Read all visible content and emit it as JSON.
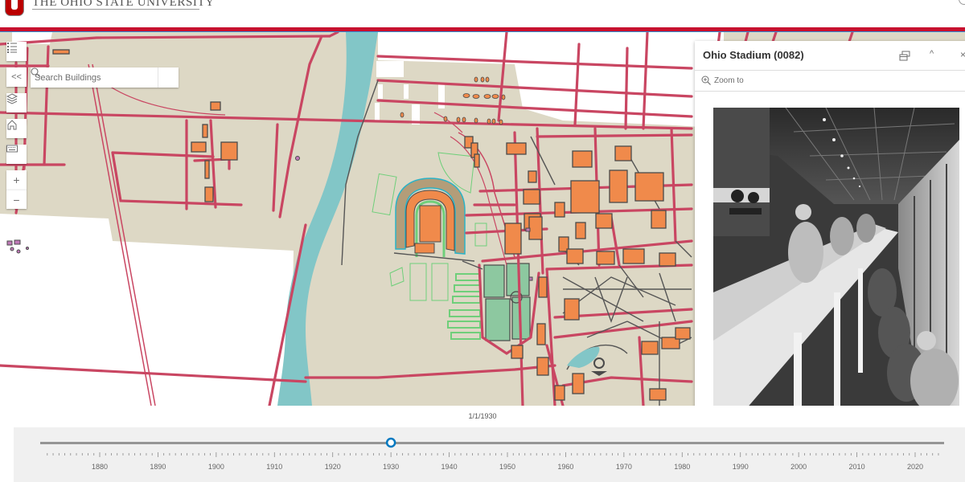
{
  "header": {
    "university_name": "THE OHIO STATE UNIVERSITY",
    "brand_color": "#c8102e"
  },
  "map_tools": {
    "legend_icon": "legend-list-icon",
    "collapse_label": "<<",
    "layers_icon": "layers-icon",
    "home_icon": "home-icon",
    "keyboard_icon": "keyboard-icon",
    "zoom_in_label": "+",
    "zoom_out_label": "−"
  },
  "search": {
    "placeholder": "Search Buildings",
    "value": ""
  },
  "popup": {
    "title": "Ohio Stadium (0082)",
    "dock_icon": "dock-icon",
    "collapse_label": "^",
    "close_label": "×",
    "zoom_to_label": "Zoom to",
    "photo_alt": "Historic black-and-white photo of Ohio Stadium press box with reporters seated along a long desk"
  },
  "map_colors": {
    "land": "#ddd8c5",
    "water": "#82c6c7",
    "roads": "#c94662",
    "buildings": "#f08a4b",
    "building_outline": "#4a4a4a",
    "fields": "#8dc8a0",
    "field_lines": "#6fcf7a",
    "paths": "#555555",
    "purple_features": "#c07ab8"
  },
  "timeline": {
    "current_date": "1/1/1930",
    "current_year": 1930,
    "start_year": 1871,
    "end_year": 2024,
    "tick_labels": [
      "1880",
      "1890",
      "1900",
      "1910",
      "1920",
      "1930",
      "1940",
      "1950",
      "1960",
      "1970",
      "1980",
      "1990",
      "2000",
      "2010",
      "2020"
    ],
    "accent_color": "#0079c1"
  }
}
